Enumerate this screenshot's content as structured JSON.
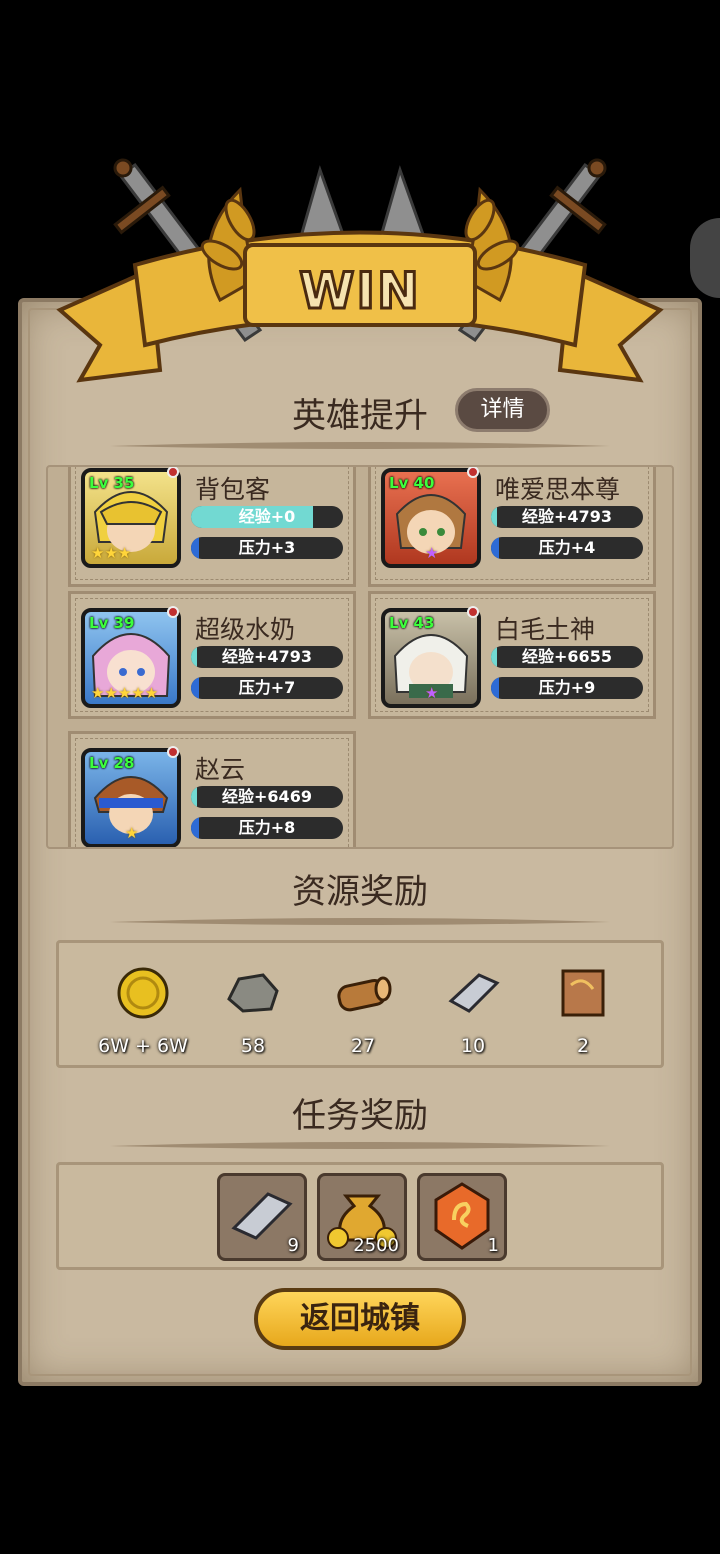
{
  "banner": {
    "title": "WIN"
  },
  "heroes_section": {
    "title": "英雄提升",
    "detail_button": "详情"
  },
  "heroes": [
    {
      "name": "背包客",
      "level": "Lv 35",
      "stars": "★★★",
      "exp": "经验+0",
      "pressure": "压力+3"
    },
    {
      "name": "唯爱思本尊",
      "level": "Lv 40",
      "stars": "★",
      "exp": "经验+4793",
      "pressure": "压力+4"
    },
    {
      "name": "超级水奶",
      "level": "Lv 39",
      "stars": "★★★★★",
      "exp": "经验+4793",
      "pressure": "压力+7"
    },
    {
      "name": "白毛土神",
      "level": "Lv 43",
      "stars": "★",
      "exp": "经验+6655",
      "pressure": "压力+9"
    },
    {
      "name": "赵云",
      "level": "Lv 28",
      "stars": "★",
      "exp": "经验+6469",
      "pressure": "压力+8"
    }
  ],
  "resources_section": {
    "title": "资源奖励"
  },
  "resources": [
    {
      "icon": "gold-coin-icon",
      "count": "6W + 6W"
    },
    {
      "icon": "stone-ore-icon",
      "count": "58"
    },
    {
      "icon": "wood-log-icon",
      "count": "27"
    },
    {
      "icon": "iron-ingot-icon",
      "count": "10"
    },
    {
      "icon": "leather-icon",
      "count": "2"
    }
  ],
  "quest_section": {
    "title": "任务奖励"
  },
  "quest_rewards": [
    {
      "icon": "iron-ingot-icon",
      "count": "9"
    },
    {
      "icon": "gold-bag-icon",
      "count": "2500"
    },
    {
      "icon": "orange-gem-icon",
      "count": "1"
    }
  ],
  "return_button": "返回城镇",
  "colors": {
    "exp_bar": "#72d9d2",
    "pressure_bar": "#2d6bd6",
    "panel": "#c9b9a0",
    "button_gold": "#f2c23c"
  }
}
